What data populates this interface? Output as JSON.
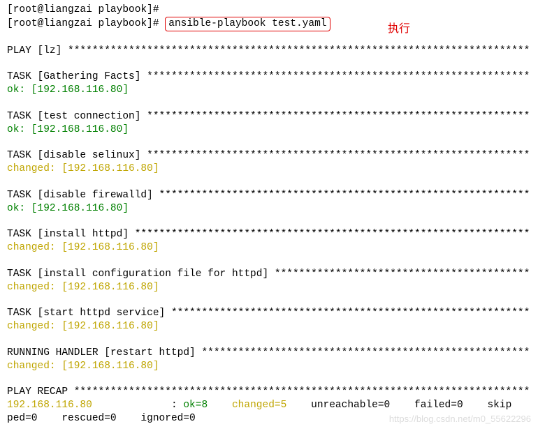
{
  "prev_prompt": "[root@liangzai playbook]#",
  "prompt": "[root@liangzai playbook]#",
  "command": "ansible-playbook test.yaml",
  "annotation": "执行",
  "play_header": "PLAY [lz] *****************************************************************************",
  "tasks": [
    {
      "header": "TASK [Gathering Facts] ****************************************************************",
      "status": "ok",
      "statusText": "ok: [192.168.116.80]"
    },
    {
      "header": "TASK [test connection] ****************************************************************",
      "status": "ok",
      "statusText": "ok: [192.168.116.80]"
    },
    {
      "header": "TASK [disable selinux] ****************************************************************",
      "status": "changed",
      "statusText": "changed: [192.168.116.80]"
    },
    {
      "header": "TASK [disable firewalld] **************************************************************",
      "status": "ok",
      "statusText": "ok: [192.168.116.80]"
    },
    {
      "header": "TASK [install httpd] ******************************************************************",
      "status": "changed",
      "statusText": "changed: [192.168.116.80]"
    },
    {
      "header": "TASK [install configuration file for httpd] *******************************************",
      "status": "changed",
      "statusText": "changed: [192.168.116.80]"
    },
    {
      "header": "TASK [start httpd service] ************************************************************",
      "status": "changed",
      "statusText": "changed: [192.168.116.80]"
    }
  ],
  "handler": {
    "header": "RUNNING HANDLER [restart httpd] *******************************************************",
    "status": "changed",
    "statusText": "changed: [192.168.116.80]"
  },
  "recap": {
    "header": "PLAY RECAP ****************************************************************************",
    "host": "192.168.116.80",
    "spacer": "             : ",
    "ok": "ok=8",
    "gap1": "    ",
    "changed": "changed=5",
    "gap2": "    ",
    "rest1": "unreachable=0    failed=0    skip",
    "rest2": "ped=0    rescued=0    ignored=0"
  },
  "watermark": "https://blog.csdn.net/m0_55622296"
}
